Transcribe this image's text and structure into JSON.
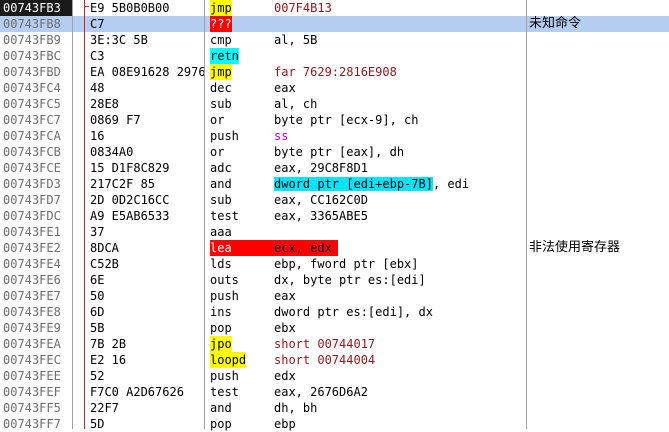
{
  "colors": {
    "background": "#ffffff",
    "selected_row": "#b4cdf0",
    "address_default": "#6e6e6e",
    "current_address_bg": "#1a1a1a",
    "current_address_fg": "#ffffff",
    "register_color": "#000000",
    "immediate_color": "#8b1a1a",
    "segment_color": "#c000c0",
    "jump_highlight": "#ffff00",
    "return_highlight": "#00ffff",
    "invalid_highlight": "#ff0000",
    "mem_highlight": "#00e5ff"
  },
  "rows": [
    {
      "addr": "00743FB3",
      "hex": "E9 5B0B0B00",
      "mnem": "jmp",
      "ops": "007F4B13",
      "mnem_style": "jmp",
      "ops_style": "imm",
      "current": true
    },
    {
      "addr": "00743FB8",
      "hex": "C7",
      "mnem": "???",
      "ops": "",
      "mnem_style": "invalid",
      "ops_style": "",
      "selected": true,
      "comment": "未知命令"
    },
    {
      "addr": "00743FB9",
      "hex": "3E:3C 5B",
      "mnem": "cmp",
      "ops": "al, 5B"
    },
    {
      "addr": "00743FBC",
      "hex": "C3",
      "mnem": "retn",
      "ops": "",
      "mnem_style": "ret"
    },
    {
      "addr": "00743FBD",
      "hex": "EA 08E91628 2976",
      "mnem": "jmp",
      "ops": "far 7629:2816E908",
      "mnem_style": "jmp",
      "ops_style": "imm"
    },
    {
      "addr": "00743FC4",
      "hex": "48",
      "mnem": "dec",
      "ops": "eax"
    },
    {
      "addr": "00743FC5",
      "hex": "28E8",
      "mnem": "sub",
      "ops": "al, ch"
    },
    {
      "addr": "00743FC7",
      "hex": "0869 F7",
      "mnem": "or",
      "ops": "byte ptr [ecx-9], ch"
    },
    {
      "addr": "00743FCA",
      "hex": "16",
      "mnem": "push",
      "ops": "ss",
      "ops_style": "seg"
    },
    {
      "addr": "00743FCB",
      "hex": "0834A0",
      "mnem": "or",
      "ops": "byte ptr [eax], dh"
    },
    {
      "addr": "00743FCE",
      "hex": "15 D1F8C829",
      "mnem": "adc",
      "ops": "eax, 29C8F8D1"
    },
    {
      "addr": "00743FD3",
      "hex": "217C2F 85",
      "mnem": "and",
      "ops": "dword ptr [edi+ebp-7B], edi",
      "mem_part": "dword ptr [edi+ebp-7B]",
      "rest_part": ", edi"
    },
    {
      "addr": "00743FD7",
      "hex": "2D 0D2C16CC",
      "mnem": "sub",
      "ops": "eax, CC162C0D"
    },
    {
      "addr": "00743FDC",
      "hex": "A9 E5AB6533",
      "mnem": "test",
      "ops": "eax, 3365ABE5"
    },
    {
      "addr": "00743FE1",
      "hex": "37",
      "mnem": "aaa",
      "ops": ""
    },
    {
      "addr": "00743FE2",
      "hex": "8DCA",
      "mnem": "lea",
      "ops": "ecx, edx",
      "mnem_style": "invalid_bar",
      "comment": "非法使用寄存器"
    },
    {
      "addr": "00743FE4",
      "hex": "C52B",
      "mnem": "lds",
      "ops": "ebp, fword ptr [ebx]"
    },
    {
      "addr": "00743FE6",
      "hex": "6E",
      "mnem": "outs",
      "ops": "dx, byte ptr es:[edi]"
    },
    {
      "addr": "00743FE7",
      "hex": "50",
      "mnem": "push",
      "ops": "eax"
    },
    {
      "addr": "00743FE8",
      "hex": "6D",
      "mnem": "ins",
      "ops": "dword ptr es:[edi], dx"
    },
    {
      "addr": "00743FE9",
      "hex": "5B",
      "mnem": "pop",
      "ops": "ebx"
    },
    {
      "addr": "00743FEA",
      "hex": "7B 2B",
      "mnem": "jpo",
      "ops": "short 00744017",
      "mnem_style": "jmp",
      "ops_style": "imm"
    },
    {
      "addr": "00743FEC",
      "hex": "E2 16",
      "mnem": "loopd",
      "ops": "short 00744004",
      "mnem_style": "jmp",
      "ops_style": "imm"
    },
    {
      "addr": "00743FEE",
      "hex": "52",
      "mnem": "push",
      "ops": "edx"
    },
    {
      "addr": "00743FEF",
      "hex": "F7C0 A2D67626",
      "mnem": "test",
      "ops": "eax, 2676D6A2"
    },
    {
      "addr": "00743FF5",
      "hex": "22F7",
      "mnem": "and",
      "ops": "dh, bh"
    },
    {
      "addr": "00743FF7",
      "hex": "5D",
      "mnem": "pop",
      "ops": "ebp"
    }
  ]
}
